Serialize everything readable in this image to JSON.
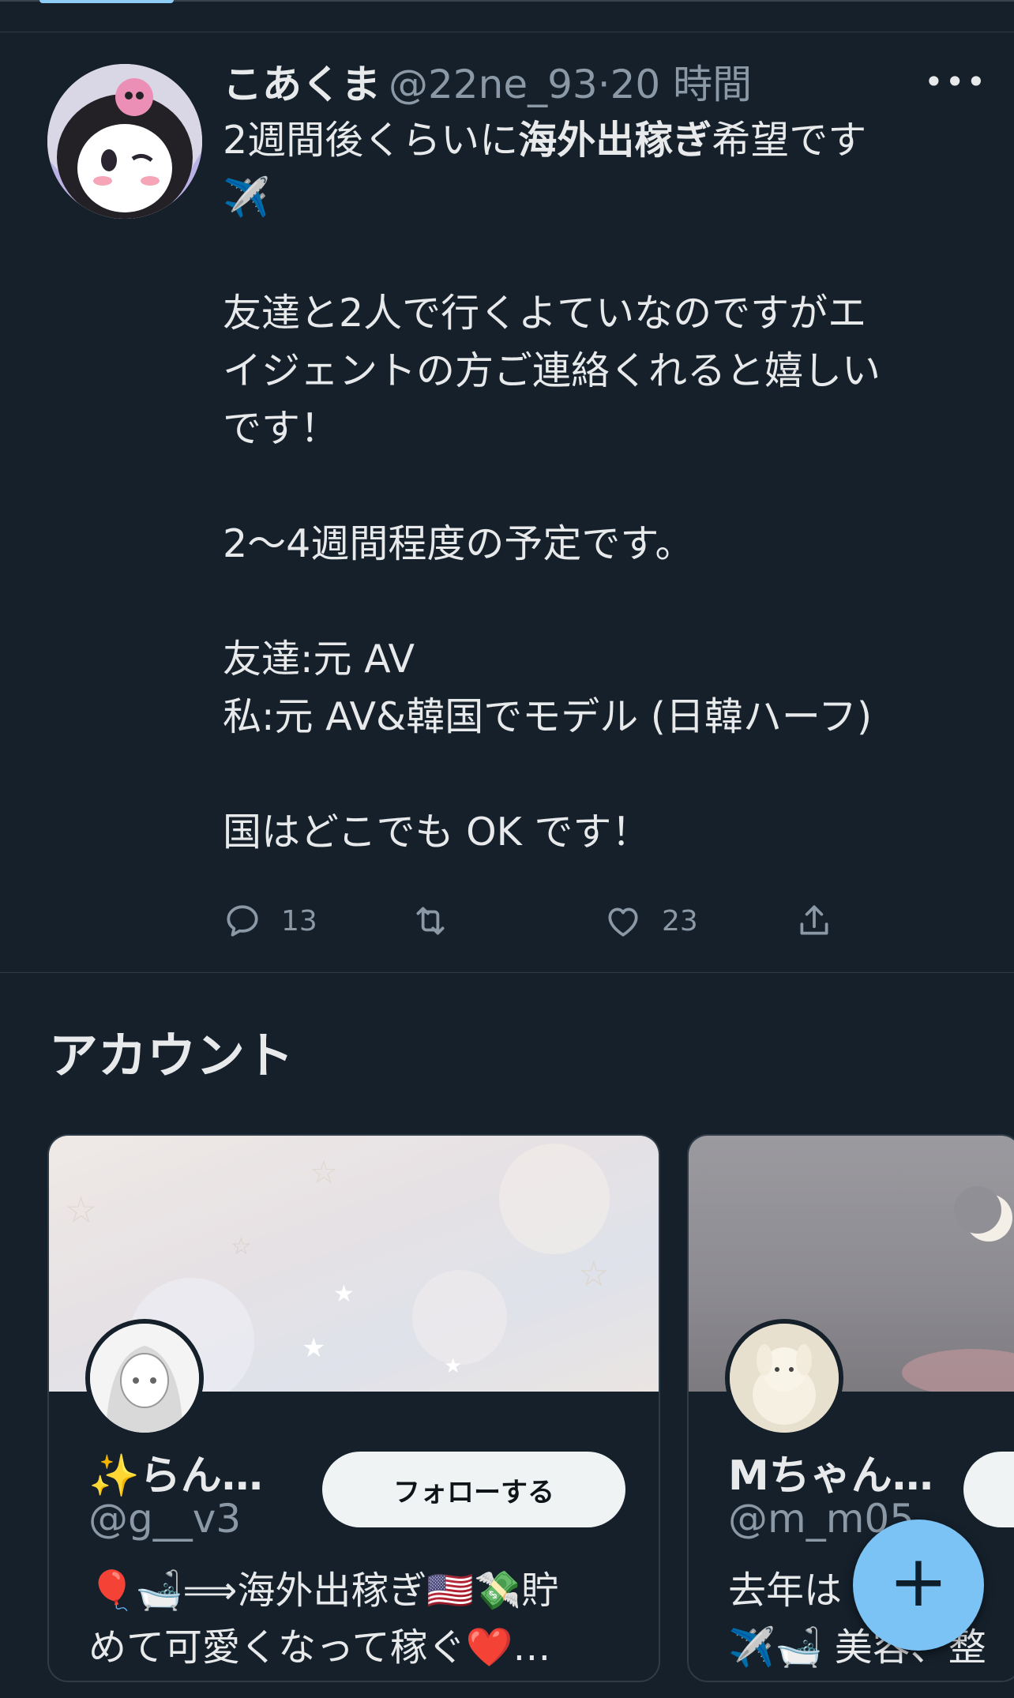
{
  "tweet": {
    "name": "こあくま",
    "handle": "@22ne_93·20 時間",
    "more": "•••",
    "line1_prefix": "2週間後くらいに",
    "line1_bold": "海外出稼ぎ",
    "line1_suffix": "希望です",
    "line2": "✈️",
    "line3": "友達と2人で行くよていなのですがエ",
    "line4": "イジェントの方ご連絡くれると嬉しい",
    "line5": "です！",
    "line6": "2〜4週間程度の予定です。",
    "line7": "友達:元 AV",
    "line8": "私:元 AV&韓国でモデル (日韓ハーフ)",
    "line9": "国はどこでも OK です！",
    "reply_count": "13",
    "like_count": "23"
  },
  "accounts": {
    "title": "アカウント",
    "follow_label": "フォローする",
    "card1": {
      "name": "✨らん…",
      "handle": "@g__v3",
      "bio1": "🎈🛁⟹海外出稼ぎ🇺🇸💸貯",
      "bio2": "めて可愛くなって稼ぐ❤️…"
    },
    "card2": {
      "name": "Mちゃん…",
      "handle": "@m_m05",
      "bio1": "去年は",
      "bio2": "✈️🛁 美容、整"
    }
  },
  "fab": {
    "label": "+"
  },
  "colors": {
    "background": "#15202b",
    "text": "#e7e9ea",
    "muted": "#8b98a5",
    "accent": "#7cc3f5"
  }
}
